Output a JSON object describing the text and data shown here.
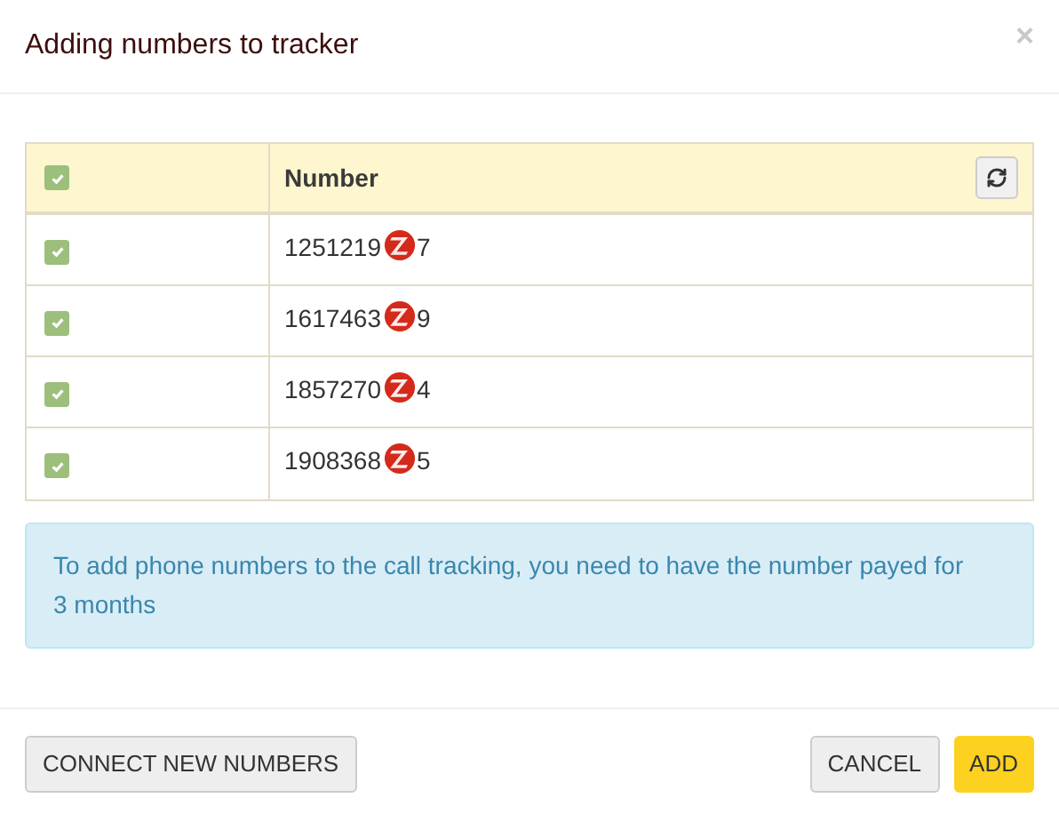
{
  "dialog": {
    "title": "Adding numbers to tracker",
    "close": "×"
  },
  "table": {
    "header": {
      "checked": true,
      "column": "Number"
    },
    "rows": [
      {
        "checked": true,
        "number_start": "1251219",
        "number_end": "7"
      },
      {
        "checked": true,
        "number_start": "1617463",
        "number_end": "9"
      },
      {
        "checked": true,
        "number_start": "1857270",
        "number_end": "4"
      },
      {
        "checked": true,
        "number_start": "1908368",
        "number_end": "5"
      }
    ]
  },
  "notice": "To add phone numbers to the call tracking, you need to have the number payed for 3 months",
  "buttons": {
    "connect": "CONNECT NEW NUMBERS",
    "cancel": "CANCEL",
    "add": "ADD"
  }
}
